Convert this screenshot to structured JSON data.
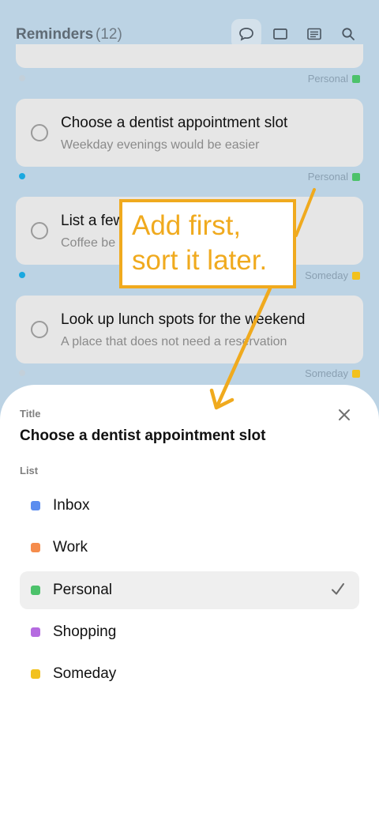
{
  "header": {
    "title": "Reminders",
    "count": "(12)",
    "icons": [
      "chat-bubble-icon",
      "square-icon",
      "list-card-icon",
      "search-icon"
    ]
  },
  "reminders": [
    {
      "title": "Choose a dentist appointment slot",
      "subtitle": "Weekday evenings would be easier",
      "list": "Personal",
      "list_color": "#4cc26b"
    },
    {
      "title": "List a few",
      "subtitle": "Coffee be",
      "list": "Someday",
      "list_color": "#f2c11e"
    },
    {
      "title": "Look up lunch spots for the weekend",
      "subtitle": "A place that does not need a reservation",
      "list": "Someday",
      "list_color": "#f2c11e"
    }
  ],
  "first_partial_tag": {
    "list": "Personal",
    "list_color": "#4cc26b"
  },
  "sheet": {
    "title_label": "Title",
    "title_value": "Choose a dentist appointment slot",
    "list_label": "List",
    "options": [
      {
        "label": "Inbox",
        "color": "#5b8def"
      },
      {
        "label": "Work",
        "color": "#f58c4c"
      },
      {
        "label": "Personal",
        "color": "#4cc26b",
        "selected": true
      },
      {
        "label": "Shopping",
        "color": "#b56be0"
      },
      {
        "label": "Someday",
        "color": "#f2c11e"
      }
    ]
  },
  "annotation": {
    "line1": "Add first,",
    "line2": "sort it later.",
    "color": "#f0aa1e"
  }
}
